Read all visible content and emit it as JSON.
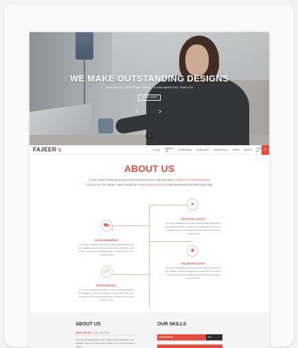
{
  "hero": {
    "headline": "WE MAKE OUTSTANDING DESIGNS",
    "subline": "WORDPRESS - BOOTSTRAP THEME - CLEAN MARKETING TEMPLATE",
    "button": "LEARN MORE",
    "prev": "‹",
    "next": "›",
    "scroll": "⌄"
  },
  "nav": {
    "logo_main": "FAJEER",
    "logo_mark": "ʼs",
    "items": [
      "HOME",
      "ABOUT US",
      "OVERVIEW",
      "SERVICES",
      "PORTFOLIO",
      "SHOP",
      "BLOG",
      "CONTACT US"
    ],
    "share": "<"
  },
  "about": {
    "title": "ABOUT US",
    "intro_1": "IT IS A LONG ESTABLISHED FACT BE DISTRACTED BY THE READABLE ",
    "intro_hl1": "CONTENT OF A PAGE WHEN LOOKING",
    "intro_2": " AT ITS LAYOUT. MANY DESKTOP ",
    "intro_hl2": "PUBLISHING PACKAGES",
    "intro_3": " AND WEB PAGE EDITORS NOW USE."
  },
  "features": [
    {
      "title": "CREATIVE LAYOUT",
      "icon": "paper-plane-icon",
      "glyph": "➤",
      "desc": "It is a long established fact that a reader will be distracted by the readable content of a page when looking at its. The point of using Lorem Ipsum Graphic Design of a that it has a more-or-less normal"
    },
    {
      "title": "WOOCOMMERCE",
      "icon": "shopping-cart-icon",
      "glyph": "⛟",
      "desc": "It is a long established fact that a reader will be distracted by the readable content of a page when looking at its. The point of using Lorem Ipsum Graphic Design of a that it has a more-or-less normal"
    },
    {
      "title": "UNLIMITED IDEAS",
      "icon": "lightbulb-icon",
      "glyph": "✺",
      "desc": "It is a long established fact that a reader will be distracted by the readable content of a page when looking at its. The point of using Lorem Ipsum Graphic Design of a that it has a more-or-less normal"
    },
    {
      "title": "RETINA READY",
      "icon": "expand-icon",
      "glyph": "⤢",
      "desc": "It is a long established fact that a reader will be distracted by the readable content of a page when looking at its. The point of using Lorem Ipsum Graphic Design of a that it has a more-or-less normal"
    }
  ],
  "bottom": {
    "about_title": "ABOUT US",
    "tab_active": "WHAT WE DO",
    "tab_other": "OUR HISTORY",
    "text": "It is a long established fact that a reader will be distracted by the readable content of a page when looking at its. The point of using Lorem",
    "skills_title": "OUR SKILLS",
    "skill_name": "WORDPRESS",
    "skill_pct": "75%",
    "skill_value": 0.75
  },
  "colors": {
    "accent": "#e74c3c",
    "dark": "#2e2e2e"
  }
}
